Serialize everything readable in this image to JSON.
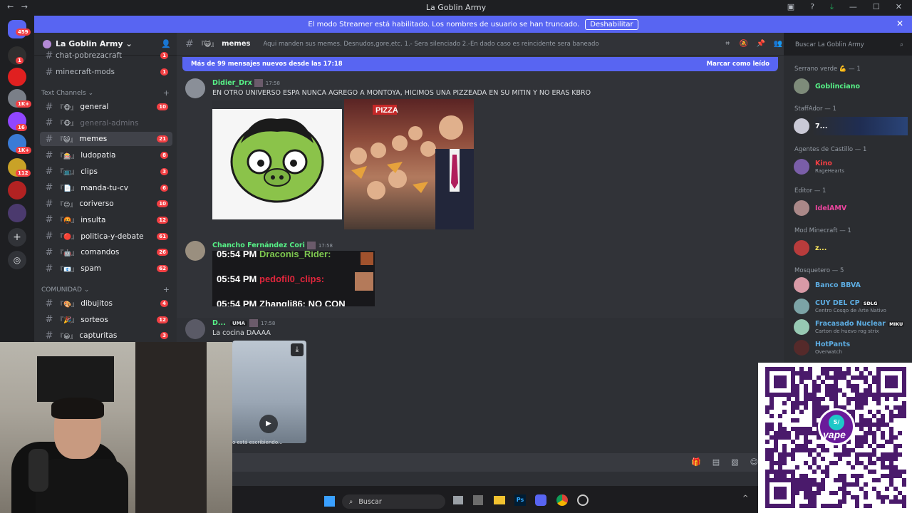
{
  "titlebar": {
    "title": "La Goblin Army"
  },
  "notice": {
    "text": "El modo Streamer está habilitado. Los nombres de usuario se han truncado.",
    "button": "Deshabilitar"
  },
  "guilds": [
    {
      "badge": "459"
    },
    {
      "badge": "1"
    },
    {
      "badge": ""
    },
    {
      "badge": "1K+"
    },
    {
      "badge": "16"
    },
    {
      "badge": "1K+"
    },
    {
      "badge": "112"
    },
    {
      "badge": ""
    },
    {
      "badge": ""
    }
  ],
  "server": {
    "name": "La Goblin Army"
  },
  "channels": {
    "top": [
      {
        "name": "chat-pobrezacraft",
        "count": "1"
      },
      {
        "name": "minecraft-mods",
        "count": "1"
      }
    ],
    "cat1": "Text Channels",
    "text": [
      {
        "emoji": "『🐵』",
        "name": "general",
        "count": "10",
        "state": "unread"
      },
      {
        "emoji": "『🐵』",
        "name": "general-admins",
        "count": "",
        "state": "muted"
      },
      {
        "emoji": "『😺』",
        "name": "memes",
        "count": "21",
        "state": "active"
      },
      {
        "emoji": "『🎰』",
        "name": "ludopatia",
        "count": "8",
        "state": "unread"
      },
      {
        "emoji": "『📺』",
        "name": "clips",
        "count": "3",
        "state": "unread"
      },
      {
        "emoji": "『📄』",
        "name": "manda-tu-cv",
        "count": "6",
        "state": "unread"
      },
      {
        "emoji": "『😊』",
        "name": "coriverso",
        "count": "10",
        "state": "unread"
      },
      {
        "emoji": "『🤬』",
        "name": "insulta",
        "count": "12",
        "state": "unread"
      },
      {
        "emoji": "『🔴』",
        "name": "politica-y-debate",
        "count": "61",
        "state": "unread"
      },
      {
        "emoji": "『🤖』",
        "name": "comandos",
        "count": "26",
        "state": "unread"
      },
      {
        "emoji": "『📧』",
        "name": "spam",
        "count": "62",
        "state": "unread"
      }
    ],
    "cat2": "COMUNIDAD",
    "comunidad": [
      {
        "emoji": "『🎨』",
        "name": "dibujitos",
        "count": "4",
        "state": "unread"
      },
      {
        "emoji": "『🎉』",
        "name": "sorteos",
        "count": "12",
        "state": "unread"
      },
      {
        "emoji": "『😀』",
        "name": "capturitas",
        "count": "3",
        "state": "unread"
      }
    ]
  },
  "chat": {
    "channel": "memes",
    "channel_emoji": "『😺』",
    "topic": "Aqui manden sus memes. Desnudos,gore,etc. 1.- Sera silenciado 2.-En dado caso es reincidente sera baneado",
    "newbar": "Más de 99 mensajes nuevos desde las 17:18",
    "mark_read": "Marcar como leído",
    "messages": [
      {
        "user": "Didier_Drx",
        "time": "17:58",
        "text": "EN OTRO UNIVERSO ESPA NUNCA AGREGO A MONTOYA, HICIMOS UNA PIZZEADA EN SU MITIN Y NO ERAS KBRO"
      },
      {
        "user": "Chancho Fernández Cori",
        "time": "17:58",
        "text": ""
      },
      {
        "user": "D...",
        "tag": "UMA",
        "time": "17:58",
        "text": "La cocina DAAAA"
      }
    ],
    "screenshot_lines": [
      {
        "time": "05:54 PM",
        "name": "Draconis_Rider:"
      },
      {
        "time": "05:54 PM",
        "name": "pedofil0_clips:"
      },
      {
        "time": "05:54 PM",
        "name": "Zhangli86: NO CON"
      }
    ],
    "pizza_sign": "PIZZA",
    "typing": "lo está escribiendo..."
  },
  "search": {
    "placeholder": "Buscar La Goblin Army"
  },
  "members": [
    {
      "role": "Serrano verde 💪 — 1",
      "users": [
        {
          "name": "Goblinciano",
          "status": "",
          "color": "#57f287"
        }
      ]
    },
    {
      "role": "StaffAdor — 1",
      "users": [
        {
          "name": "7...",
          "status": "",
          "color": "#ffffff"
        }
      ]
    },
    {
      "role": "Agentes de Castillo — 1",
      "users": [
        {
          "name": "Kino",
          "status": "RageHearts",
          "color": "#f23f43"
        }
      ]
    },
    {
      "role": "Editor — 1",
      "users": [
        {
          "name": "IdelAMV",
          "status": "",
          "color": "#eb459e"
        }
      ]
    },
    {
      "role": "Mod Minecraft — 1",
      "users": [
        {
          "name": "z...",
          "status": "",
          "color": "#fee75c"
        }
      ]
    },
    {
      "role": "Mosquetero — 5",
      "users": [
        {
          "name": "Banco BBVA",
          "status": "",
          "color": "#5dade2"
        },
        {
          "name": "CUY DEL CP",
          "status": "Centro Cosqo de Arte Nativo",
          "color": "#5dade2",
          "tag": "SDLG"
        },
        {
          "name": "Fracasado Nuclear",
          "status": "Carton de huevo rog strix",
          "color": "#5dade2",
          "tag": "MIKU"
        },
        {
          "name": "HotPants",
          "status": "Overwatch",
          "color": "#5dade2"
        }
      ]
    }
  ],
  "taskbar": {
    "search": "Buscar"
  },
  "qr": {
    "brand": "yape",
    "badge": "S/"
  }
}
